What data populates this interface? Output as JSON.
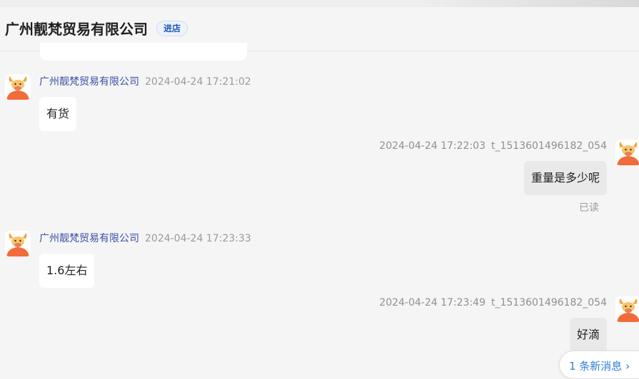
{
  "header": {
    "shop_name": "广州靓梵贸易有限公司",
    "enter_shop_label": "进店"
  },
  "messages": [
    {
      "direction": "in",
      "sender": "广州靓梵贸易有限公司",
      "time": "2024-04-24 17:21:02",
      "text": "有货"
    },
    {
      "direction": "out",
      "sender": "t_1513601496182_054",
      "time": "2024-04-24 17:22:03",
      "text": "重量是多少呢",
      "status": "已读"
    },
    {
      "direction": "in",
      "sender": "广州靓梵贸易有限公司",
      "time": "2024-04-24 17:23:33",
      "text": "1.6左右"
    },
    {
      "direction": "out",
      "sender": "t_1513601496182_054",
      "time": "2024-04-24 17:23:49",
      "text": "好滴"
    }
  ],
  "new_message_pill": "1 条新消息 ›",
  "colors": {
    "background": "#f5f5f5",
    "sender_name": "#3b4ea8",
    "timestamp": "#9a9a9a",
    "incoming_bubble": "#ffffff",
    "outgoing_bubble": "#e9e9e9",
    "enter_shop_text": "#1e56b8",
    "new_message_text": "#2f7fd8",
    "avatar_body": "#f26b3a"
  },
  "icons": {
    "avatar": "cartoon-bull-avatar-icon"
  }
}
